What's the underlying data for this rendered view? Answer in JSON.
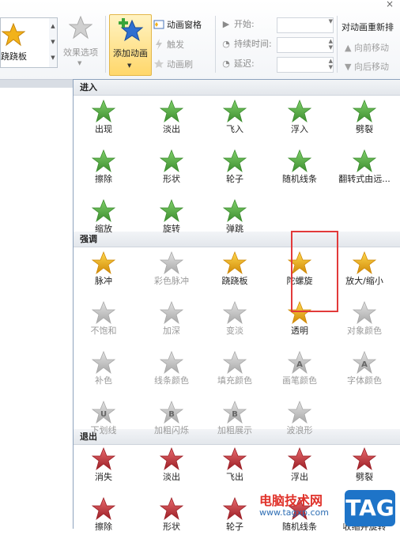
{
  "ribbon": {
    "close_glyph": "×",
    "current_effect_label": "跷跷板",
    "effect_options_label": "效果选项",
    "add_animation_label": "添加动画",
    "animation_pane_label": "动画窗格",
    "trigger_label": "触发",
    "animation_painter_label": "动画刷",
    "start_label": "开始:",
    "duration_label": "持续时间:",
    "delay_label": "延迟:",
    "reorder_title": "对动画重新排",
    "move_earlier_label": "向前移动",
    "move_later_label": "向后移动"
  },
  "gallery": {
    "sections": [
      {
        "title": "进入",
        "items": [
          {
            "label": "出现",
            "color": "green",
            "enabled": true
          },
          {
            "label": "淡出",
            "color": "green",
            "enabled": true
          },
          {
            "label": "飞入",
            "color": "green",
            "enabled": true
          },
          {
            "label": "浮入",
            "color": "green",
            "enabled": true
          },
          {
            "label": "劈裂",
            "color": "green",
            "enabled": true
          },
          {
            "label": "擦除",
            "color": "green",
            "enabled": true
          },
          {
            "label": "形状",
            "color": "green",
            "enabled": true
          },
          {
            "label": "轮子",
            "color": "green",
            "enabled": true
          },
          {
            "label": "随机线条",
            "color": "green",
            "enabled": true
          },
          {
            "label": "翻转式由远...",
            "color": "green",
            "enabled": true
          },
          {
            "label": "缩放",
            "color": "green",
            "enabled": true
          },
          {
            "label": "旋转",
            "color": "green",
            "enabled": true
          },
          {
            "label": "弹跳",
            "color": "green",
            "enabled": true
          }
        ]
      },
      {
        "title": "强调",
        "items": [
          {
            "label": "脉冲",
            "color": "gold",
            "enabled": true
          },
          {
            "label": "彩色脉冲",
            "color": "gray",
            "enabled": false
          },
          {
            "label": "跷跷板",
            "color": "gold",
            "enabled": true
          },
          {
            "label": "陀螺旋",
            "color": "gold",
            "enabled": true
          },
          {
            "label": "放大/缩小",
            "color": "gold",
            "enabled": true
          },
          {
            "label": "不饱和",
            "color": "gray",
            "enabled": false
          },
          {
            "label": "加深",
            "color": "gray",
            "enabled": false
          },
          {
            "label": "变淡",
            "color": "gray",
            "enabled": false
          },
          {
            "label": "透明",
            "color": "gold",
            "enabled": true
          },
          {
            "label": "对象颜色",
            "color": "gray",
            "enabled": false
          },
          {
            "label": "补色",
            "color": "gray",
            "enabled": false
          },
          {
            "label": "线条颜色",
            "color": "gray",
            "enabled": false
          },
          {
            "label": "填充颜色",
            "color": "gray",
            "enabled": false
          },
          {
            "label": "画笔颜色",
            "color": "gray",
            "enabled": false
          },
          {
            "label": "字体颜色",
            "color": "gray",
            "enabled": false
          },
          {
            "label": "下划线",
            "color": "gray",
            "enabled": false
          },
          {
            "label": "加粗闪烁",
            "color": "gray",
            "enabled": false
          },
          {
            "label": "加粗展示",
            "color": "gray",
            "enabled": false
          },
          {
            "label": "波浪形",
            "color": "gray",
            "enabled": false
          }
        ]
      },
      {
        "title": "退出",
        "items": [
          {
            "label": "消失",
            "color": "red",
            "enabled": true
          },
          {
            "label": "淡出",
            "color": "red",
            "enabled": true
          },
          {
            "label": "飞出",
            "color": "red",
            "enabled": true
          },
          {
            "label": "浮出",
            "color": "red",
            "enabled": true
          },
          {
            "label": "劈裂",
            "color": "red",
            "enabled": true
          },
          {
            "label": "擦除",
            "color": "red",
            "enabled": true
          },
          {
            "label": "形状",
            "color": "red",
            "enabled": true
          },
          {
            "label": "轮子",
            "color": "red",
            "enabled": true
          },
          {
            "label": "随机线条",
            "color": "red",
            "enabled": true
          },
          {
            "label": "收缩并旋转",
            "color": "red",
            "enabled": true
          }
        ]
      }
    ],
    "letter_marks": {
      "下划线": "U",
      "加粗闪烁": "B",
      "加粗展示": "B",
      "画笔颜色": "A",
      "字体颜色": "A"
    }
  },
  "watermark": {
    "site_name": "电脑技术网",
    "url": "www.tagxp.com",
    "logo_text": "TAG"
  },
  "colors": {
    "green": "#4a9a3a",
    "gold": "#f2b21a",
    "gray": "#b5b5b5",
    "red": "#c0282e",
    "highlight": "#e23a3a",
    "accent": "#ffd76b"
  }
}
